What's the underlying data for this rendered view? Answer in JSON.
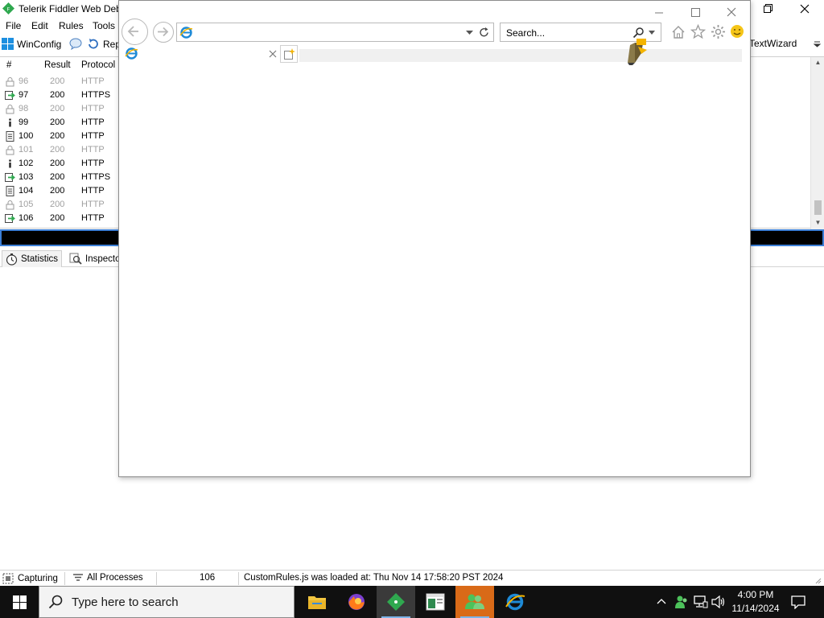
{
  "fiddler": {
    "title": "Telerik Fiddler Web Debu",
    "menu": [
      "File",
      "Edit",
      "Rules",
      "Tools"
    ],
    "toolbar": {
      "winconfig": "WinConfig",
      "replay": "Rep",
      "textwizard": "TextWizard"
    },
    "columns": {
      "num": "#",
      "result": "Result",
      "protocol": "Protocol"
    },
    "sessions": [
      {
        "num": "96",
        "result": "200",
        "protocol": "HTTP",
        "icon": "lock-icon",
        "dim": true
      },
      {
        "num": "97",
        "result": "200",
        "protocol": "HTTPS",
        "icon": "forward-arrow-icon",
        "dim": false
      },
      {
        "num": "98",
        "result": "200",
        "protocol": "HTTP",
        "icon": "lock-icon",
        "dim": true
      },
      {
        "num": "99",
        "result": "200",
        "protocol": "HTTP",
        "icon": "info-icon",
        "dim": false
      },
      {
        "num": "100",
        "result": "200",
        "protocol": "HTTP",
        "icon": "document-icon",
        "dim": false
      },
      {
        "num": "101",
        "result": "200",
        "protocol": "HTTP",
        "icon": "lock-icon",
        "dim": true
      },
      {
        "num": "102",
        "result": "200",
        "protocol": "HTTP",
        "icon": "info-icon",
        "dim": false
      },
      {
        "num": "103",
        "result": "200",
        "protocol": "HTTPS",
        "icon": "forward-arrow-icon",
        "dim": false
      },
      {
        "num": "104",
        "result": "200",
        "protocol": "HTTP",
        "icon": "document-icon",
        "dim": false
      },
      {
        "num": "105",
        "result": "200",
        "protocol": "HTTP",
        "icon": "lock-icon",
        "dim": true
      },
      {
        "num": "106",
        "result": "200",
        "protocol": "HTTP",
        "icon": "forward-arrow-icon",
        "dim": false
      }
    ],
    "tabs": {
      "statistics": "Statistics",
      "inspectors": "Inspecto"
    },
    "status": {
      "capturing": "Capturing",
      "processes": "All Processes",
      "count": "106",
      "message": "CustomRules.js was loaded at: Thu Nov 14 17:58:20 PST 2024"
    }
  },
  "ie": {
    "address": "",
    "search_placeholder": "Search..."
  },
  "taskbar": {
    "search_placeholder": "Type here to search",
    "time": "4:00 PM",
    "date": "11/14/2024"
  },
  "colors": {
    "accent_blue": "#3c7fd6",
    "taskbar_bg": "#101010",
    "fiddler_green": "#2fa84f",
    "ie_blue": "#1e8ad6"
  }
}
